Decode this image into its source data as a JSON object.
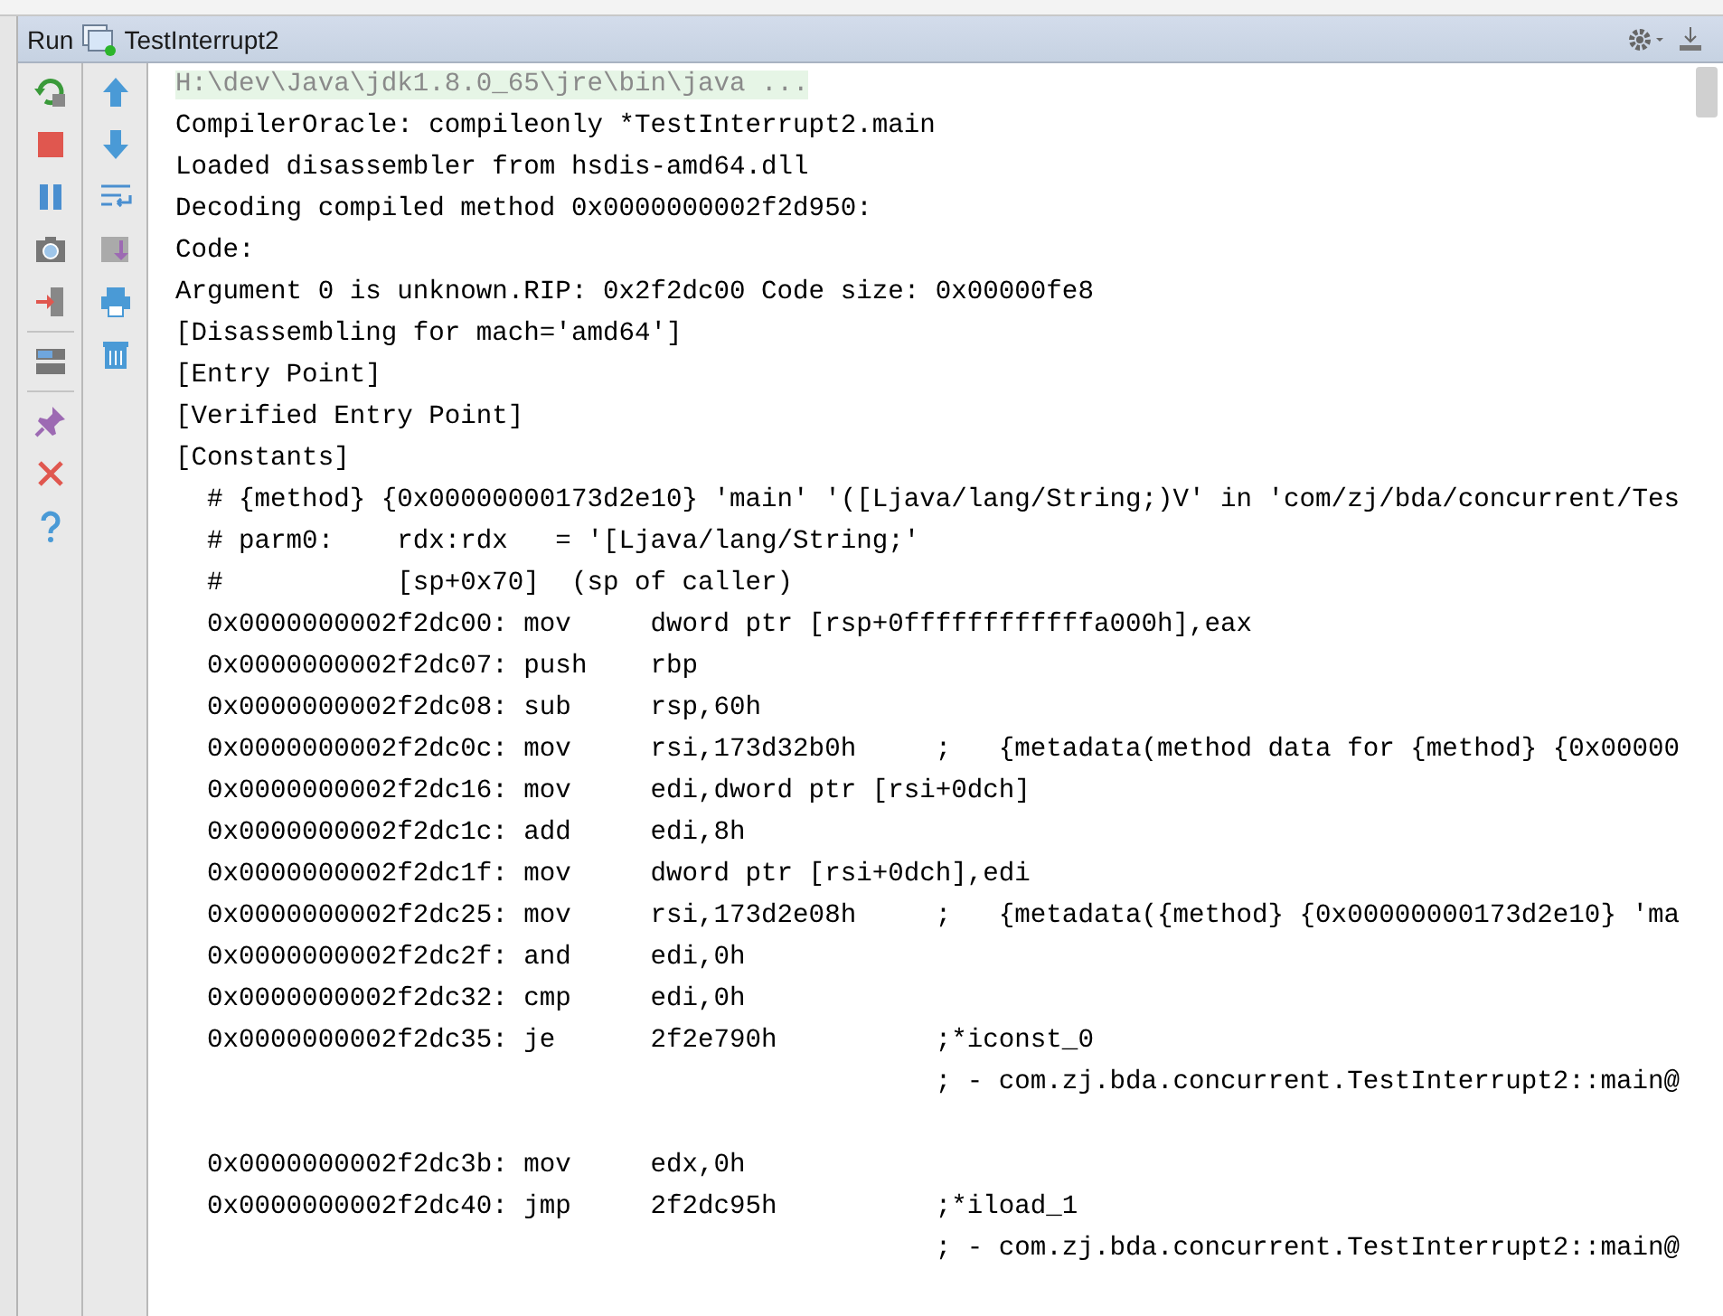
{
  "tool_window": {
    "title": "Run",
    "tab": {
      "label": "TestInterrupt2",
      "running": true
    }
  },
  "console": {
    "lines": [
      {
        "kind": "command",
        "text": "H:\\dev\\Java\\jdk1.8.0_65\\jre\\bin\\java ..."
      },
      {
        "kind": "output",
        "text": "CompilerOracle: compileonly *TestInterrupt2.main"
      },
      {
        "kind": "output",
        "text": "Loaded disassembler from hsdis-amd64.dll"
      },
      {
        "kind": "output",
        "text": "Decoding compiled method 0x0000000002f2d950:"
      },
      {
        "kind": "output",
        "text": "Code:"
      },
      {
        "kind": "output",
        "text": "Argument 0 is unknown.RIP: 0x2f2dc00 Code size: 0x00000fe8"
      },
      {
        "kind": "output",
        "text": "[Disassembling for mach='amd64']"
      },
      {
        "kind": "output",
        "text": "[Entry Point]"
      },
      {
        "kind": "output",
        "text": "[Verified Entry Point]"
      },
      {
        "kind": "output",
        "text": "[Constants]"
      },
      {
        "kind": "output",
        "text": "  # {method} {0x00000000173d2e10} 'main' '([Ljava/lang/String;)V' in 'com/zj/bda/concurrent/Tes"
      },
      {
        "kind": "output",
        "text": "  # parm0:    rdx:rdx   = '[Ljava/lang/String;'"
      },
      {
        "kind": "output",
        "text": "  #           [sp+0x70]  (sp of caller)"
      },
      {
        "kind": "output",
        "text": "  0x0000000002f2dc00: mov     dword ptr [rsp+0ffffffffffffa000h],eax"
      },
      {
        "kind": "output",
        "text": "  0x0000000002f2dc07: push    rbp"
      },
      {
        "kind": "output",
        "text": "  0x0000000002f2dc08: sub     rsp,60h"
      },
      {
        "kind": "output",
        "text": "  0x0000000002f2dc0c: mov     rsi,173d32b0h     ;   {metadata(method data for {method} {0x00000"
      },
      {
        "kind": "output",
        "text": "  0x0000000002f2dc16: mov     edi,dword ptr [rsi+0dch]"
      },
      {
        "kind": "output",
        "text": "  0x0000000002f2dc1c: add     edi,8h"
      },
      {
        "kind": "output",
        "text": "  0x0000000002f2dc1f: mov     dword ptr [rsi+0dch],edi"
      },
      {
        "kind": "output",
        "text": "  0x0000000002f2dc25: mov     rsi,173d2e08h     ;   {metadata({method} {0x00000000173d2e10} 'ma"
      },
      {
        "kind": "output",
        "text": "  0x0000000002f2dc2f: and     edi,0h"
      },
      {
        "kind": "output",
        "text": "  0x0000000002f2dc32: cmp     edi,0h"
      },
      {
        "kind": "output",
        "text": "  0x0000000002f2dc35: je      2f2e790h          ;*iconst_0"
      },
      {
        "kind": "output",
        "text": "                                                ; - com.zj.bda.concurrent.TestInterrupt2::main@"
      },
      {
        "kind": "blank"
      },
      {
        "kind": "output",
        "text": "  0x0000000002f2dc3b: mov     edx,0h"
      },
      {
        "kind": "output",
        "text": "  0x0000000002f2dc40: jmp     2f2dc95h          ;*iload_1"
      },
      {
        "kind": "output",
        "text": "                                                ; - com.zj.bda.concurrent.TestInterrupt2::main@"
      }
    ]
  }
}
